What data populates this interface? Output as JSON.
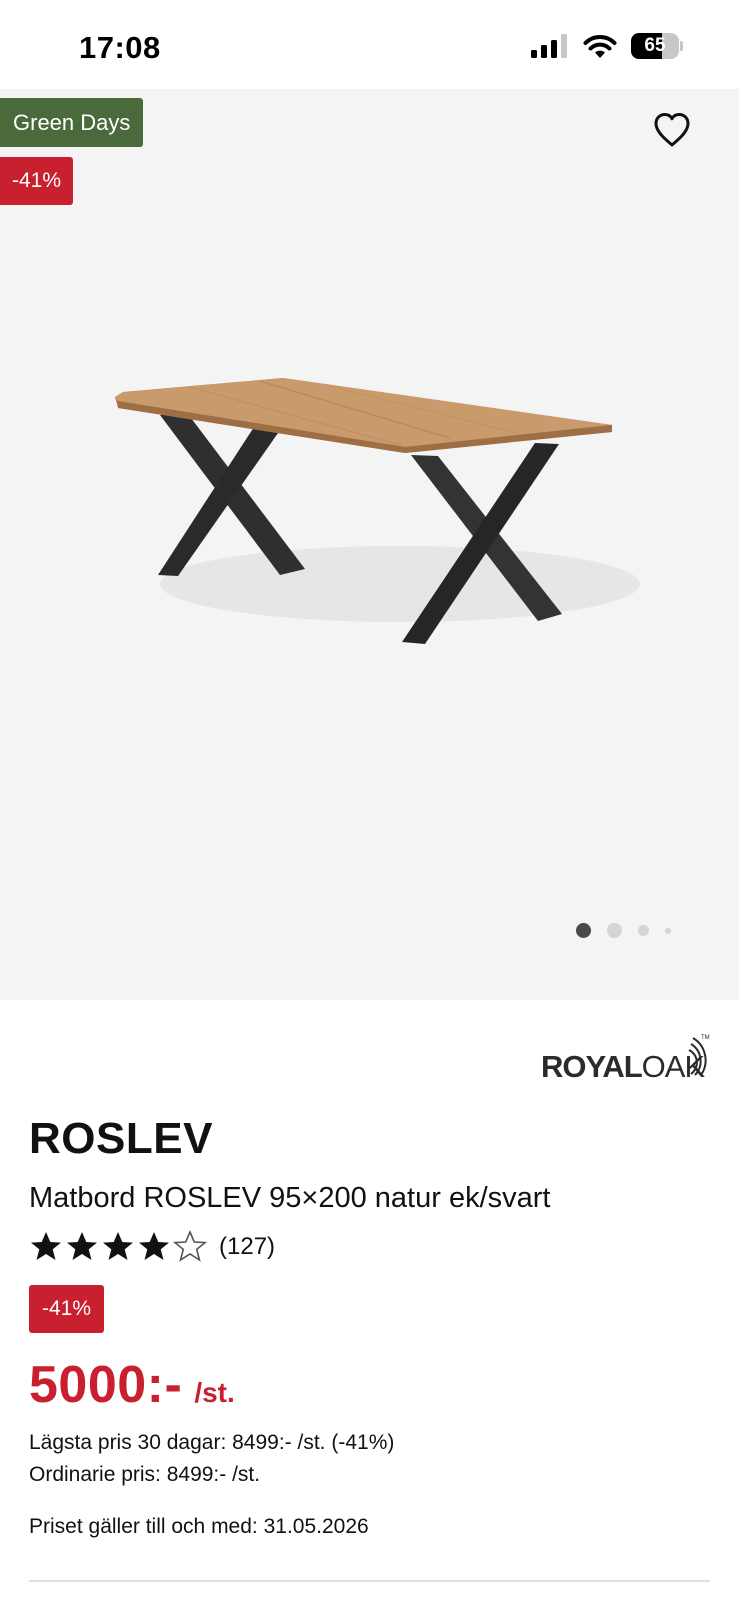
{
  "status_bar": {
    "time": "17:08",
    "battery_level": 65,
    "battery_text": "65",
    "signal_icon": "cellular-signal-icon",
    "wifi_icon": "wifi-icon"
  },
  "hero": {
    "campaign_badge": "Green Days",
    "discount_badge": "-41%",
    "favorite_icon": "heart-outline-icon",
    "image_count": 4,
    "active_image_index": 0
  },
  "product": {
    "brand_logo_text": "ROYALOAK",
    "brand": "ROSLEV",
    "title": "Matbord ROSLEV 95×200 natur ek/svart",
    "rating": 4,
    "rating_max": 5,
    "review_count": "(127)",
    "discount_badge": "-41%",
    "price": "5000:-",
    "price_unit": "/st.",
    "lowest_price": "Lägsta pris 30 dagar: 8499:- /st. (-41%)",
    "regular_price": "Ordinarie pris: 8499:- /st.",
    "price_valid": "Priset gäller till och med: 31.05.2026"
  },
  "colors": {
    "sale_red": "#c8202f",
    "campaign_green": "#4a6a3c",
    "hero_background": "#f4f4f4"
  }
}
